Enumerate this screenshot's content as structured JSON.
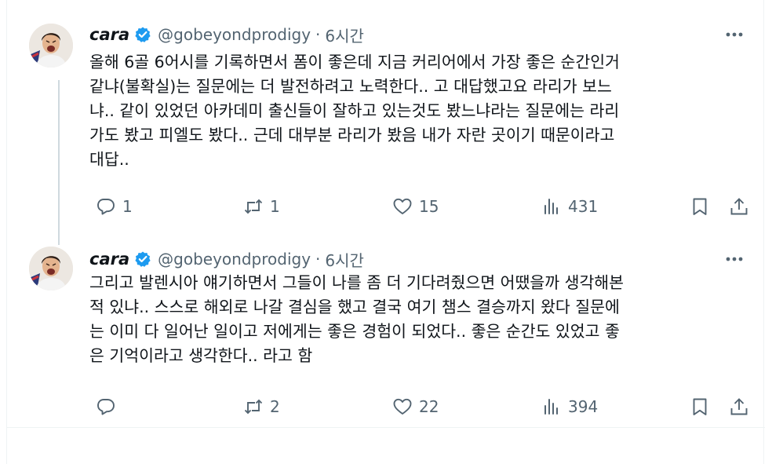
{
  "colors": {
    "text_primary": "#0f1419",
    "text_secondary": "#536471",
    "verified_blue": "#1d9bf0",
    "thread_line": "#cfd9de",
    "divider": "#eff3f4"
  },
  "tweets": [
    {
      "author": {
        "name": "cara",
        "handle": "@gobeyondprodigy",
        "verified": true,
        "avatar_icon": "avatar-photo"
      },
      "separator": "·",
      "time": "6시간",
      "text": "올해 6골 6어시를 기록하면서 폼이 좋은데 지금 커리어에서 가장 좋은 순간인거\n같냐(불확실)는 질문에는 더 발전하려고 노력한다.. 고 대답했고요 라리가 보느\n냐.. 같이 있었던 아카데미 출신들이 잘하고 있는것도 봤느냐라는 질문에는 라리\n가도 봤고 피엘도 봤다.. 근데 대부분 라리가 봤음 내가 자란 곳이기 때문이라고\n대답..",
      "actions": {
        "replies": "1",
        "retweets": "1",
        "likes": "15",
        "views": "431"
      }
    },
    {
      "author": {
        "name": "cara",
        "handle": "@gobeyondprodigy",
        "verified": true,
        "avatar_icon": "avatar-photo"
      },
      "separator": "·",
      "time": "6시간",
      "text": "그리고 발렌시아 얘기하면서 그들이 나를 좀 더 기다려줬으면 어땠을까 생각해본\n적 있냐.. 스스로 해외로 나갈 결심을 했고 결국 여기 챔스 결승까지 왔다 질문에\n는 이미 다 일어난 일이고 저에게는 좋은 경험이 되었다.. 좋은 순간도 있었고 좋\n은 기억이라고 생각한다.. 라고 함",
      "actions": {
        "replies": "",
        "retweets": "2",
        "likes": "22",
        "views": "394"
      }
    }
  ],
  "icons": {
    "verified": "verified-badge-icon",
    "more": "more-horizontal-icon",
    "reply": "reply-icon",
    "retweet": "retweet-icon",
    "like": "heart-icon",
    "views": "views-bar-chart-icon",
    "bookmark": "bookmark-icon",
    "share": "share-icon"
  }
}
